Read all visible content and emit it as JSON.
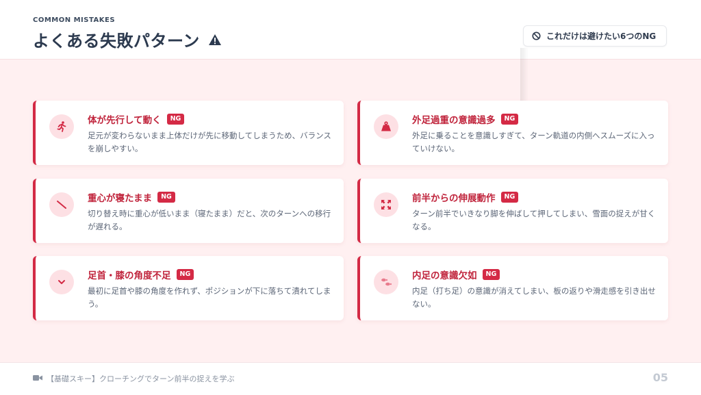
{
  "header": {
    "eyebrow": "COMMON MISTAKES",
    "title": "よくある失敗パターン",
    "title_icon": "warning-triangle-icon",
    "chip_label": "これだけは避けたい6つのNG",
    "chip_icon": "prohibited-icon"
  },
  "colors": {
    "accent": "#d32a45",
    "title_red": "#c0243c",
    "background": "#fff0f1",
    "icon_bg": "#fde0e4"
  },
  "cards": [
    {
      "title": "体が先行して動く",
      "badge": "NG",
      "icon": "running-person-icon",
      "desc": "足元が変わらないまま上体だけが先に移動してしまうため、バランスを崩しやすい。"
    },
    {
      "title": "外足過重の意識過多",
      "badge": "NG",
      "icon": "weight-icon",
      "desc": "外足に乗ることを意識しすぎて、ターン軌道の内側へスムーズに入っていけない。"
    },
    {
      "title": "重心が寝たまま",
      "badge": "NG",
      "icon": "diagonal-line-icon",
      "desc": "切り替え時に重心が低いまま（寝たまま）だと、次のターンへの移行が遅れる。"
    },
    {
      "title": "前半からの伸展動作",
      "badge": "NG",
      "icon": "expand-arrows-icon",
      "desc": "ターン前半でいきなり脚を伸ばして押してしまい、雪面の捉えが甘くなる。"
    },
    {
      "title": "足首・膝の角度不足",
      "badge": "NG",
      "icon": "chevron-down-icon",
      "desc": "最初に足首や膝の角度を作れず、ポジションが下に落ちて潰れてしまう。"
    },
    {
      "title": "内足の意識欠如",
      "badge": "NG",
      "icon": "footprints-icon",
      "desc": "内足（打ち足）の意識が消えてしまい、板の返りや滑走感を引き出せない。"
    }
  ],
  "footer": {
    "text": "【基礎スキー】クローチングでターン前半の捉えを学ぶ",
    "icon": "video-camera-icon",
    "page": "05"
  }
}
